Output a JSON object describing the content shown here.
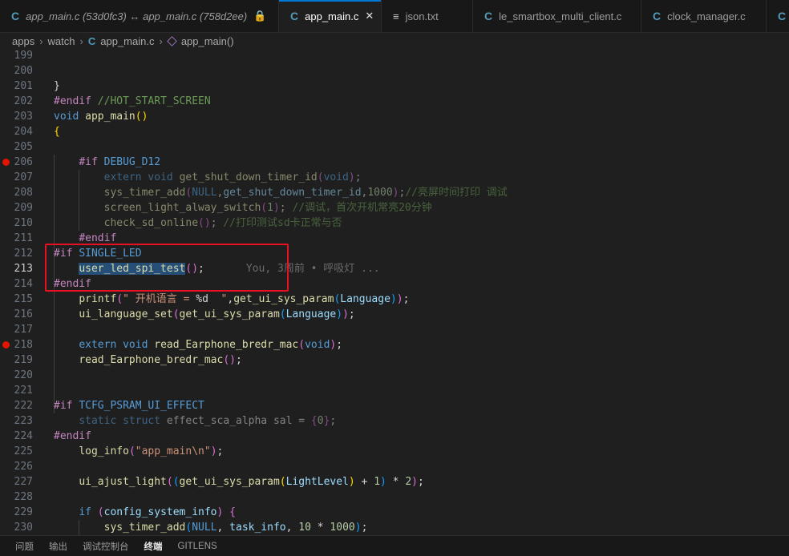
{
  "tabs": [
    {
      "icon": "C",
      "label": "app_main.c (53d0fc3) ↔ app_main.c (758d2ee)",
      "italic": true,
      "action": "🔒",
      "active": false
    },
    {
      "icon": "C",
      "label": "app_main.c",
      "italic": false,
      "action": "✕",
      "active": true
    },
    {
      "icon": "≡",
      "label": "json.txt",
      "italic": false,
      "action": "",
      "active": false
    },
    {
      "icon": "C",
      "label": "le_smartbox_multi_client.c",
      "italic": false,
      "action": "",
      "active": false
    },
    {
      "icon": "C",
      "label": "clock_manager.c",
      "italic": false,
      "action": "",
      "active": false
    },
    {
      "icon": "C",
      "label": "",
      "italic": false,
      "action": "",
      "active": false
    }
  ],
  "breadcrumb": {
    "items": [
      "apps",
      "watch",
      "app_main.c",
      "app_main()"
    ]
  },
  "blame": "You, 3周前 • 呼吸灯 ...",
  "lines": [
    {
      "n": "199",
      "code": []
    },
    {
      "n": "200",
      "code": []
    },
    {
      "n": "201",
      "code": [
        [
          "pl",
          "}"
        ]
      ]
    },
    {
      "n": "202",
      "code": [
        [
          "pp",
          "#endif "
        ],
        [
          "cm",
          "//HOT_START_SCREEN"
        ]
      ]
    },
    {
      "n": "203",
      "code": [
        [
          "kw",
          "void "
        ],
        [
          "fn",
          "app_main"
        ],
        [
          "br1",
          "()"
        ]
      ]
    },
    {
      "n": "204",
      "code": [
        [
          "br1",
          "{"
        ]
      ]
    },
    {
      "n": "205",
      "code": []
    },
    {
      "n": "206",
      "bp": true,
      "code": [
        [
          "pl",
          "    "
        ],
        [
          "pp",
          "#if "
        ],
        [
          "mac",
          "DEBUG_D12"
        ]
      ]
    },
    {
      "n": "207",
      "dim": true,
      "code": [
        [
          "pl",
          "        "
        ],
        [
          "kw",
          "extern "
        ],
        [
          "kw",
          "void "
        ],
        [
          "fn",
          "get_shut_down_timer_id"
        ],
        [
          "br2",
          "("
        ],
        [
          "kw",
          "void"
        ],
        [
          "br2",
          ")"
        ],
        [
          "pl",
          ";"
        ]
      ]
    },
    {
      "n": "208",
      "dim": true,
      "code": [
        [
          "pl",
          "        "
        ],
        [
          "fn",
          "sys_timer_add"
        ],
        [
          "br2",
          "("
        ],
        [
          "kw",
          "NULL"
        ],
        [
          "pl",
          ","
        ],
        [
          "id",
          "get_shut_down_timer_id"
        ],
        [
          "pl",
          ","
        ],
        [
          "num",
          "1000"
        ],
        [
          "br2",
          ")"
        ],
        [
          "pl",
          ";"
        ],
        [
          "cm",
          "//亮屏时间打印 调试"
        ]
      ]
    },
    {
      "n": "209",
      "dim": true,
      "code": [
        [
          "pl",
          "        "
        ],
        [
          "fn",
          "screen_light_alway_switch"
        ],
        [
          "br2",
          "("
        ],
        [
          "num",
          "1"
        ],
        [
          "br2",
          ")"
        ],
        [
          "pl",
          "; "
        ],
        [
          "cm",
          "//调试，首次开机常亮20分钟"
        ]
      ]
    },
    {
      "n": "210",
      "dim": true,
      "code": [
        [
          "pl",
          "        "
        ],
        [
          "fn",
          "check_sd_online"
        ],
        [
          "br2",
          "()"
        ],
        [
          "pl",
          "; "
        ],
        [
          "cm",
          "//打印测试sd卡正常与否"
        ]
      ]
    },
    {
      "n": "211",
      "code": [
        [
          "pl",
          "    "
        ],
        [
          "pp",
          "#endif"
        ]
      ]
    },
    {
      "n": "212",
      "code": [
        [
          "pp",
          "#if "
        ],
        [
          "mac",
          "SINGLE_LED"
        ]
      ]
    },
    {
      "n": "213",
      "cur": true,
      "code": [
        [
          "pl",
          "    "
        ],
        [
          "fnsel",
          "user_led_spi_test"
        ],
        [
          "br2",
          "()"
        ],
        [
          "pl",
          ";"
        ],
        [
          "blame",
          ""
        ]
      ]
    },
    {
      "n": "214",
      "code": [
        [
          "pp",
          "#endif"
        ]
      ]
    },
    {
      "n": "215",
      "code": [
        [
          "pl",
          "    "
        ],
        [
          "fn",
          "printf"
        ],
        [
          "br2",
          "("
        ],
        [
          "str",
          "\" 开机语言 = "
        ],
        [
          "pl",
          "%d"
        ],
        [
          "str",
          "  \""
        ],
        [
          "pl",
          ","
        ],
        [
          "fn",
          "get_ui_sys_param"
        ],
        [
          "br3",
          "("
        ],
        [
          "id",
          "Language"
        ],
        [
          "br3",
          ")"
        ],
        [
          "br2",
          ")"
        ],
        [
          "pl",
          ";"
        ]
      ]
    },
    {
      "n": "216",
      "code": [
        [
          "pl",
          "    "
        ],
        [
          "fn",
          "ui_language_set"
        ],
        [
          "br2",
          "("
        ],
        [
          "fn",
          "get_ui_sys_param"
        ],
        [
          "br3",
          "("
        ],
        [
          "id",
          "Language"
        ],
        [
          "br3",
          ")"
        ],
        [
          "br2",
          ")"
        ],
        [
          "pl",
          ";"
        ]
      ]
    },
    {
      "n": "217",
      "code": []
    },
    {
      "n": "218",
      "bp": true,
      "code": [
        [
          "pl",
          "    "
        ],
        [
          "kw",
          "extern "
        ],
        [
          "kw",
          "void "
        ],
        [
          "fn",
          "read_Earphone_bredr_mac"
        ],
        [
          "br2",
          "("
        ],
        [
          "kw",
          "void"
        ],
        [
          "br2",
          ")"
        ],
        [
          "pl",
          ";"
        ]
      ]
    },
    {
      "n": "219",
      "code": [
        [
          "pl",
          "    "
        ],
        [
          "fn",
          "read_Earphone_bredr_mac"
        ],
        [
          "br2",
          "()"
        ],
        [
          "pl",
          ";"
        ]
      ]
    },
    {
      "n": "220",
      "code": []
    },
    {
      "n": "221",
      "code": []
    },
    {
      "n": "222",
      "code": [
        [
          "pp",
          "#if "
        ],
        [
          "mac",
          "TCFG_PSRAM_UI_EFFECT"
        ]
      ]
    },
    {
      "n": "223",
      "dim": true,
      "code": [
        [
          "pl",
          "    "
        ],
        [
          "kw",
          "static "
        ],
        [
          "kw",
          "struct "
        ],
        [
          "pl",
          "effect_sca_alpha sal = "
        ],
        [
          "br2",
          "{"
        ],
        [
          "num",
          "0"
        ],
        [
          "br2",
          "}"
        ],
        [
          "pl",
          ";"
        ]
      ]
    },
    {
      "n": "224",
      "code": [
        [
          "pp",
          "#endif"
        ]
      ]
    },
    {
      "n": "225",
      "code": [
        [
          "pl",
          "    "
        ],
        [
          "fn",
          "log_info"
        ],
        [
          "br2",
          "("
        ],
        [
          "str",
          "\"app_main\\n\""
        ],
        [
          "br2",
          ")"
        ],
        [
          "pl",
          ";"
        ]
      ]
    },
    {
      "n": "226",
      "code": []
    },
    {
      "n": "227",
      "code": [
        [
          "pl",
          "    "
        ],
        [
          "fn",
          "ui_ajust_light"
        ],
        [
          "br2",
          "("
        ],
        [
          "br3",
          "("
        ],
        [
          "fn",
          "get_ui_sys_param"
        ],
        [
          "br1",
          "("
        ],
        [
          "id",
          "LightLevel"
        ],
        [
          "br1",
          ")"
        ],
        [
          "pl",
          " + "
        ],
        [
          "num",
          "1"
        ],
        [
          "br3",
          ")"
        ],
        [
          "pl",
          " * "
        ],
        [
          "num",
          "2"
        ],
        [
          "br2",
          ")"
        ],
        [
          "pl",
          ";"
        ]
      ]
    },
    {
      "n": "228",
      "code": []
    },
    {
      "n": "229",
      "code": [
        [
          "pl",
          "    "
        ],
        [
          "kw",
          "if "
        ],
        [
          "br2",
          "("
        ],
        [
          "id",
          "config_system_info"
        ],
        [
          "br2",
          ")"
        ],
        [
          "pl",
          " "
        ],
        [
          "br2",
          "{"
        ]
      ]
    },
    {
      "n": "230",
      "code": [
        [
          "pl",
          "        "
        ],
        [
          "fn",
          "sys_timer_add"
        ],
        [
          "br3",
          "("
        ],
        [
          "kw",
          "NULL"
        ],
        [
          "pl",
          ", "
        ],
        [
          "id",
          "task_info"
        ],
        [
          "pl",
          ", "
        ],
        [
          "num",
          "10"
        ],
        [
          "pl",
          " * "
        ],
        [
          "num",
          "1000"
        ],
        [
          "br3",
          ")"
        ],
        [
          "pl",
          ";"
        ]
      ]
    }
  ],
  "panel_tabs": [
    "问题",
    "输出",
    "调试控制台",
    "终端",
    "GITLENS"
  ],
  "panel_active": 3,
  "colors": {
    "accent": "#0078d4",
    "breakpoint": "#e51400",
    "highlight_box": "#e81123"
  }
}
